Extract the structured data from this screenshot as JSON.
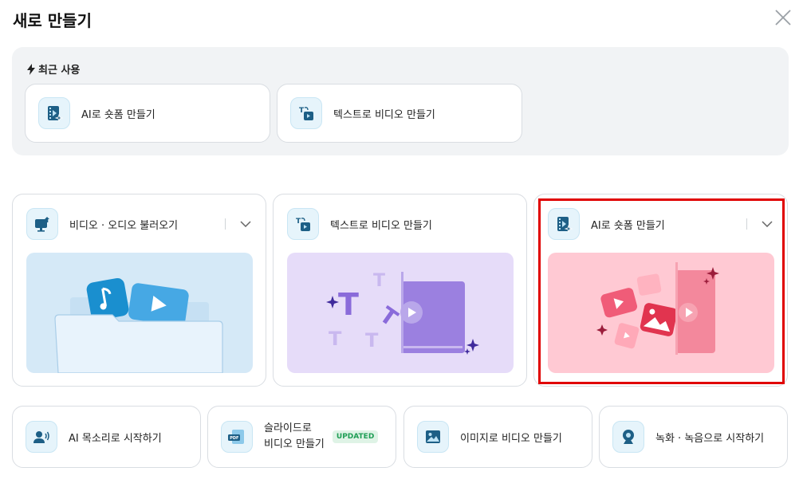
{
  "dialog": {
    "title": "새로 만들기"
  },
  "recent": {
    "label": "최근 사용",
    "items": [
      {
        "label": "AI로 숏폼 만들기",
        "icon": "film-sparkle-icon"
      },
      {
        "label": "텍스트로 비디오 만들기",
        "icon": "text-to-video-icon"
      }
    ]
  },
  "cards": [
    {
      "label": "비디오 · 오디오 불러오기",
      "icon": "monitor-upload-icon",
      "has_dropdown": true
    },
    {
      "label": "텍스트로 비디오 만들기",
      "icon": "text-to-video-icon",
      "has_dropdown": false
    },
    {
      "label": "AI로 숏폼 만들기",
      "icon": "film-sparkle-icon",
      "has_dropdown": true,
      "highlighted": true
    }
  ],
  "bottom": [
    {
      "label": "AI 목소리로 시작하기",
      "icon": "voice-icon"
    },
    {
      "label_line1": "슬라이드로",
      "label_line2": "비디오 만들기",
      "badge": "UPDATED",
      "icon": "pdf-icon"
    },
    {
      "label": "이미지로 비디오 만들기",
      "icon": "image-icon"
    },
    {
      "label": "녹화 · 녹음으로 시작하기",
      "icon": "webcam-icon"
    }
  ],
  "colors": {
    "accent": "#1a8fcf",
    "highlight": "#e00000",
    "badge_bg": "#dff3e6",
    "badge_fg": "#1f9e55"
  }
}
